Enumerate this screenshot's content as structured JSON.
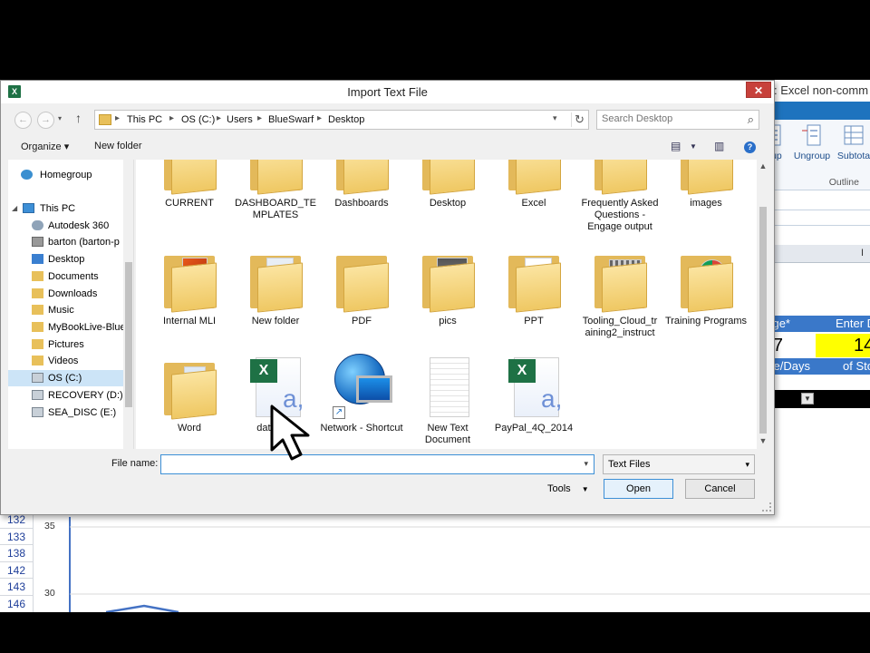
{
  "dialog": {
    "title": "Import Text File",
    "close_label": "✕",
    "app_icon": "X"
  },
  "navigation": {
    "back_label": "←",
    "forward_label": "→",
    "up_label": "↑",
    "breadcrumb": [
      "This PC",
      "OS (C:)",
      "Users",
      "BlueSwarf",
      "Desktop"
    ],
    "search_placeholder": "Search Desktop"
  },
  "toolbar": {
    "organize_label": "Organize ▾",
    "new_folder_label": "New folder"
  },
  "nav_pane": {
    "items": [
      {
        "label": "Homegroup",
        "icon": "homegroup-icon"
      },
      {
        "label": "This PC",
        "icon": "computer-icon"
      },
      {
        "label": "Autodesk 360",
        "icon": "cloud-icon"
      },
      {
        "label": "barton (barton-p",
        "icon": "network-drive-icon"
      },
      {
        "label": "Desktop",
        "icon": "folder-icon"
      },
      {
        "label": "Documents",
        "icon": "folder-icon"
      },
      {
        "label": "Downloads",
        "icon": "folder-icon"
      },
      {
        "label": "Music",
        "icon": "folder-icon"
      },
      {
        "label": "MyBookLive-Blue",
        "icon": "folder-icon"
      },
      {
        "label": "Pictures",
        "icon": "folder-icon"
      },
      {
        "label": "Videos",
        "icon": "folder-icon"
      },
      {
        "label": "OS (C:)",
        "icon": "drive-icon"
      },
      {
        "label": "RECOVERY (D:)",
        "icon": "drive-icon"
      },
      {
        "label": "SEA_DISC (E:)",
        "icon": "drive-icon"
      }
    ]
  },
  "files": {
    "row1": [
      "CURRENT",
      "DASHBOARD_TE MPLATES",
      "Dashboards",
      "Desktop",
      "Excel",
      "Frequently Asked Questions - Engage output",
      "images"
    ],
    "row2": [
      "Internal MLI",
      "New folder",
      "PDF",
      "pics",
      "PPT",
      "Tooling_Cloud_tr aining2_instruct",
      "Training Programs"
    ],
    "row3": [
      "Word",
      "datadow",
      "Network - Shortcut",
      "New Text Document",
      "PayPal_4Q_2014"
    ]
  },
  "bottom": {
    "file_name_label": "File name:",
    "file_name_value": "",
    "filter_value": "Text Files",
    "tools_label": "Tools",
    "open_label": "Open",
    "cancel_label": "Cancel"
  },
  "excel": {
    "title_fragment": ": Excel non-comm",
    "ribbon": {
      "group_label": "oup",
      "ungroup_label": "Ungroup",
      "subtotal_label": "Subtota",
      "outline_label": "Outline"
    },
    "column_letter": "I",
    "cells": {
      "header_left": "ge*",
      "header_right": "Enter D",
      "value_left": "7",
      "value_right": "14",
      "sub_left": "e/Days",
      "sub_right": "of Sto"
    },
    "row_numbers": [
      "132",
      "133",
      "138",
      "142",
      "143",
      "146"
    ],
    "chart_ticks": [
      "35",
      "30"
    ],
    "colors": {
      "header_blue": "#3a78c9",
      "yellow": "#ffff00",
      "black": "#000000"
    }
  }
}
